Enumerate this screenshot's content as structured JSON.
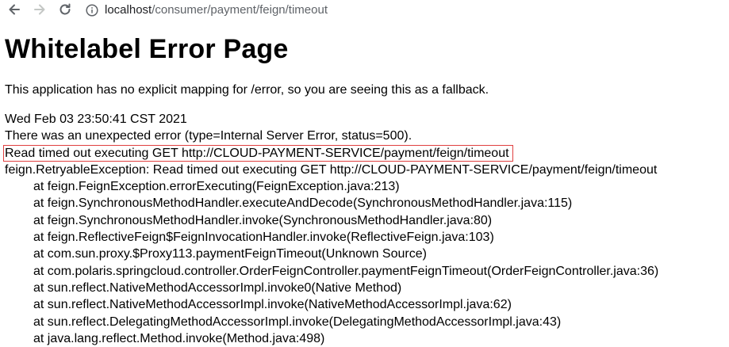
{
  "browser": {
    "url_host": "localhost",
    "url_path": "/consumer/payment/feign/timeout"
  },
  "page": {
    "title": "Whitelabel Error Page",
    "fallback": "This application has no explicit mapping for /error, so you are seeing this as a fallback.",
    "timestamp": "Wed Feb 03 23:50:41 CST 2021",
    "error_line": "There was an unexpected error (type=Internal Server Error, status=500).",
    "message": "Read timed out executing GET http://CLOUD-PAYMENT-SERVICE/payment/feign/timeout",
    "exception": "feign.RetryableException: Read timed out executing GET http://CLOUD-PAYMENT-SERVICE/payment/feign/timeout",
    "stack": [
      "at feign.FeignException.errorExecuting(FeignException.java:213)",
      "at feign.SynchronousMethodHandler.executeAndDecode(SynchronousMethodHandler.java:115)",
      "at feign.SynchronousMethodHandler.invoke(SynchronousMethodHandler.java:80)",
      "at feign.ReflectiveFeign$FeignInvocationHandler.invoke(ReflectiveFeign.java:103)",
      "at com.sun.proxy.$Proxy113.paymentFeignTimeout(Unknown Source)",
      "at com.polaris.springcloud.controller.OrderFeignController.paymentFeignTimeout(OrderFeignController.java:36)",
      "at sun.reflect.NativeMethodAccessorImpl.invoke0(Native Method)",
      "at sun.reflect.NativeMethodAccessorImpl.invoke(NativeMethodAccessorImpl.java:62)",
      "at sun.reflect.DelegatingMethodAccessorImpl.invoke(DelegatingMethodAccessorImpl.java:43)",
      "at java.lang.reflect.Method.invoke(Method.java:498)"
    ]
  },
  "colors": {
    "highlight_border": "#e04040"
  }
}
